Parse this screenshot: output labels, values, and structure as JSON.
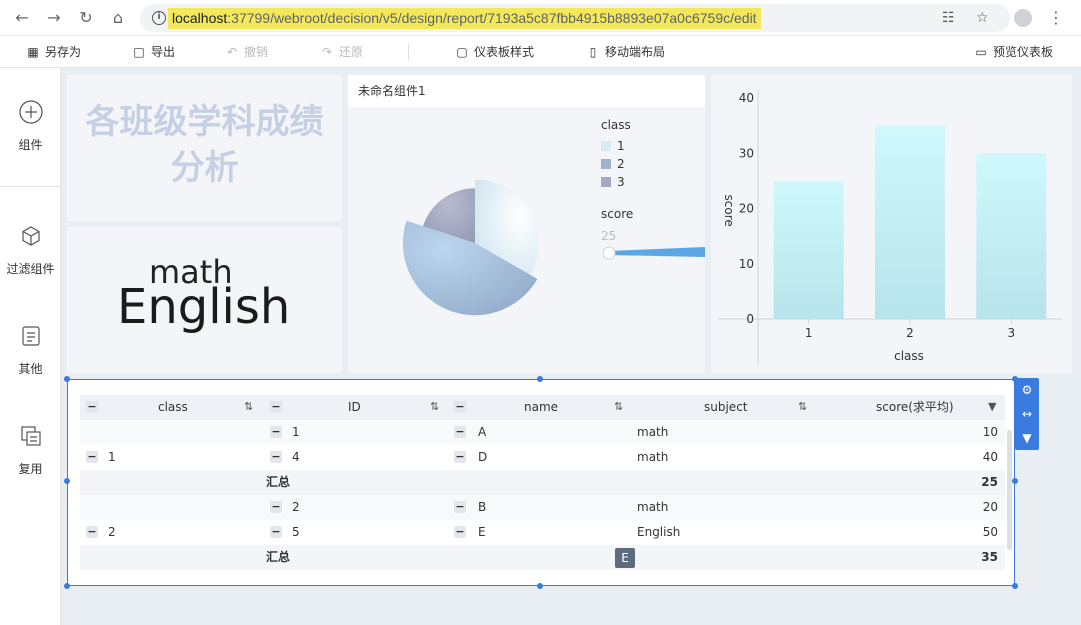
{
  "browser": {
    "url_host": "localhost",
    "url_path": ":37799/webroot/decision/v5/design/report/7193a5c87fbb4915b8893e07a0c6759c/edit"
  },
  "toolbar": {
    "save_as": "另存为",
    "export": "导出",
    "undo": "撤销",
    "redo": "还原",
    "dashboard_style": "仪表板样式",
    "mobile_layout": "移动端布局",
    "preview": "预览仪表板"
  },
  "sidebar": {
    "items": [
      {
        "label": "组件",
        "icon": "add-circle-icon"
      },
      {
        "label": "过滤组件",
        "icon": "cube-icon"
      },
      {
        "label": "其他",
        "icon": "document-icon"
      },
      {
        "label": "复用",
        "icon": "copy-icon"
      }
    ]
  },
  "title_panel": {
    "text_line1": "各班级学科成绩",
    "text_line2": "分析",
    "color": "#c6d0e4"
  },
  "word_cloud": {
    "words": [
      "math",
      "English"
    ]
  },
  "pie_panel": {
    "title": "未命名组件1",
    "legend_class_title": "class",
    "legend_items": [
      {
        "label": "1",
        "color": "#d8ecf6"
      },
      {
        "label": "2",
        "color": "#9fb4cc"
      },
      {
        "label": "3",
        "color": "#a3a9c0"
      }
    ],
    "legend_size_title": "score",
    "size_min_label": "25"
  },
  "chart_data": [
    {
      "type": "pie",
      "categories": [
        "1",
        "2",
        "3"
      ],
      "values": [
        25,
        35,
        15
      ],
      "colors": [
        "#e4f2f9",
        "#a8c2e0",
        "#a3a8c2"
      ]
    },
    {
      "type": "bar",
      "categories": [
        "1",
        "2",
        "3"
      ],
      "values": [
        25,
        35,
        30
      ],
      "xlabel": "class",
      "ylabel": "score",
      "ylim": [
        0,
        40
      ],
      "yticks": [
        0,
        10,
        20,
        30,
        40
      ],
      "bar_color_top": "#cff9fc",
      "bar_color_bottom": "#b7e3ea"
    }
  ],
  "table": {
    "headers": [
      "class",
      "ID",
      "name",
      "subject",
      "score(求平均)"
    ],
    "groups": [
      {
        "class": "1",
        "rows": [
          {
            "id": "1",
            "name": "A",
            "subject": "math",
            "score": "10"
          },
          {
            "id": "4",
            "name": "D",
            "subject": "math",
            "score": "40"
          }
        ],
        "subtotal_label": "汇总",
        "subtotal": "25"
      },
      {
        "class": "2",
        "rows": [
          {
            "id": "2",
            "name": "B",
            "subject": "math",
            "score": "20"
          },
          {
            "id": "5",
            "name": "E",
            "subject": "English",
            "score": "50"
          }
        ],
        "subtotal_label": "汇总",
        "subtotal": "35"
      }
    ],
    "drag_badge": "E",
    "accent": "#3a7be0"
  }
}
